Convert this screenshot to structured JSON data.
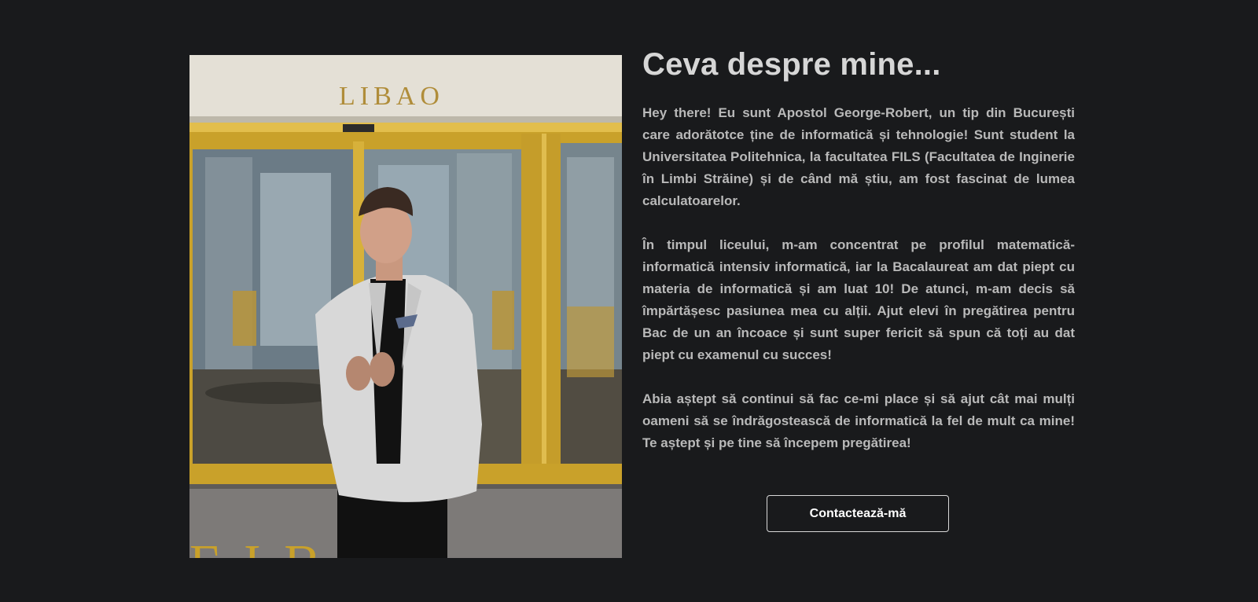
{
  "about": {
    "title": "Ceva despre mine...",
    "paragraphs": [
      "Hey there! Eu sunt Apostol George-Robert, un tip din București care adorătotce ține de informatică și tehnologie! Sunt student la Universitatea Politehnica, la facultatea FILS (Facultatea de Inginerie în Limbi Străine) și de când mă știu, am fost fascinat de lumea calculatoarelor.",
      "În timpul liceului, m-am concentrat pe profilul matematică-informatică intensiv informatică, iar la Bacalaureat am dat piept cu materia de informatică și am luat 10! De atunci, m-am decis să împărtășesc pasiunea mea cu alții. Ajut elevi în pregătirea pentru Bac de un an încoace și sunt super fericit să spun că toți au dat piept cu examenul cu succes!",
      "Abia aștept să continui să fac ce-mi place și să ajut cât mai mulți oameni să se îndrăgostească de informatică la fel de mult ca mine! Te aștept și pe tine să începem pregătirea!"
    ]
  },
  "photo": {
    "sign_text": "LIBAO",
    "floor_text": "LIBAO"
  },
  "cta": {
    "label": "Contactează-mă"
  },
  "colors": {
    "background": "#191a1c",
    "title": "#d6d6d6",
    "body_text": "#b9b9b9",
    "button_border": "#d9d9d9",
    "button_text": "#ffffff"
  }
}
